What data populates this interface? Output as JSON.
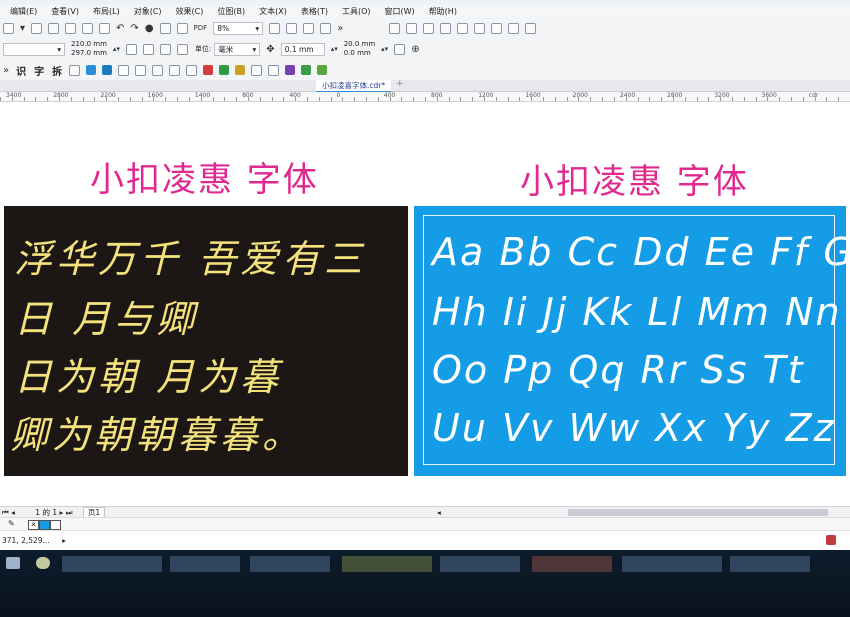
{
  "menu": [
    "编辑(E)",
    "查看(V)",
    "布局(L)",
    "对象(C)",
    "效果(C)",
    "位图(B)",
    "文本(X)",
    "表格(T)",
    "工具(O)",
    "窗口(W)",
    "帮助(H)"
  ],
  "toolbar1": {
    "zoom": "8%",
    "pdf_label": "PDF"
  },
  "toolbar2": {
    "width": "210.0 mm",
    "height": "297.0 mm",
    "units_label": "单位:",
    "units_value": "毫米",
    "nudge": "0.1 mm",
    "dup_x": "20.0 mm",
    "dup_y": "0.0 mm"
  },
  "toolbar3": {
    "tools": [
      "识",
      "字",
      "拆"
    ]
  },
  "document_tab": "小扣凌喜字体.cdr*",
  "ruler_labels": [
    "3400",
    "2800",
    "2200",
    "1600",
    "1400",
    "800",
    "400",
    "0",
    "400",
    "800",
    "1200",
    "1600",
    "2000",
    "2400",
    "2800",
    "3200",
    "3600",
    "cdr"
  ],
  "canvas": {
    "left_heading": "小扣凌惠 字体",
    "right_heading": "小扣凌惠 字体",
    "poem_lines": [
      "浮华万千 吾爱有三",
      "日 月与卿",
      "日为朝 月为暮",
      "卿为朝朝暮暮。"
    ],
    "alphabet_lines": [
      "Aa Bb Cc Dd Ee Ff Gg",
      "Hh Ii Jj Kk Ll Mm Nn",
      "Oo Pp Qq Rr Ss Tt",
      "Uu Vv Ww Xx Yy Zz"
    ],
    "left_bg": "#1c1714",
    "left_text_color": "#f4e27c",
    "right_bg": "#149ce6",
    "heading_color": "#e0288f"
  },
  "pagebar": {
    "page_current": "1",
    "page_of": "的",
    "page_total": "1",
    "page_tab": "页1"
  },
  "status": {
    "coords": "371, 2,529..."
  }
}
